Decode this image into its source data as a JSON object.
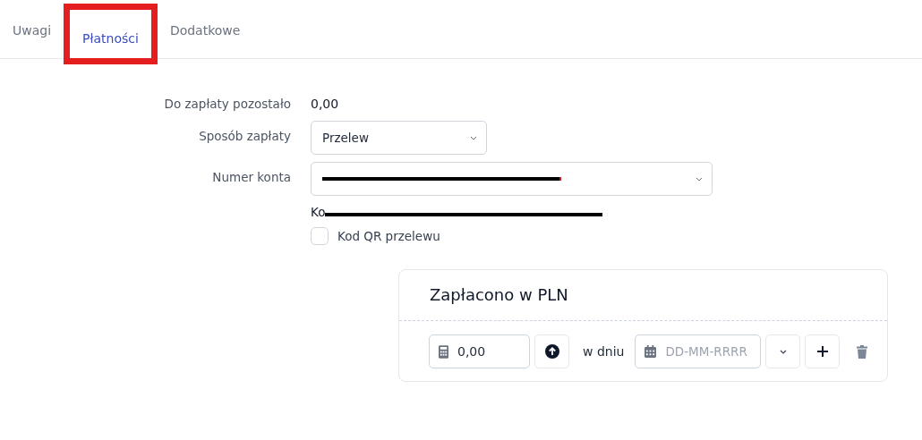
{
  "tabs": [
    {
      "label": "Uwagi",
      "selected": false,
      "highlighted": false
    },
    {
      "label": "Płatności",
      "selected": true,
      "highlighted": true
    },
    {
      "label": "Dodatkowe",
      "selected": false,
      "highlighted": false
    }
  ],
  "form": {
    "remaining_label": "Do zapłaty pozostało",
    "remaining_value": "0,00",
    "method_label": "Sposób zapłaty",
    "method_value": "Przelew",
    "account_label": "Numer konta",
    "bank_note": "Ko",
    "qr": {
      "label": "Kod QR przelewu",
      "checked": false
    }
  },
  "paid": {
    "title": "Zapłacono w PLN",
    "amount": "0,00",
    "date_label": "w dniu",
    "date_placeholder": "DD-MM-RRRR"
  }
}
